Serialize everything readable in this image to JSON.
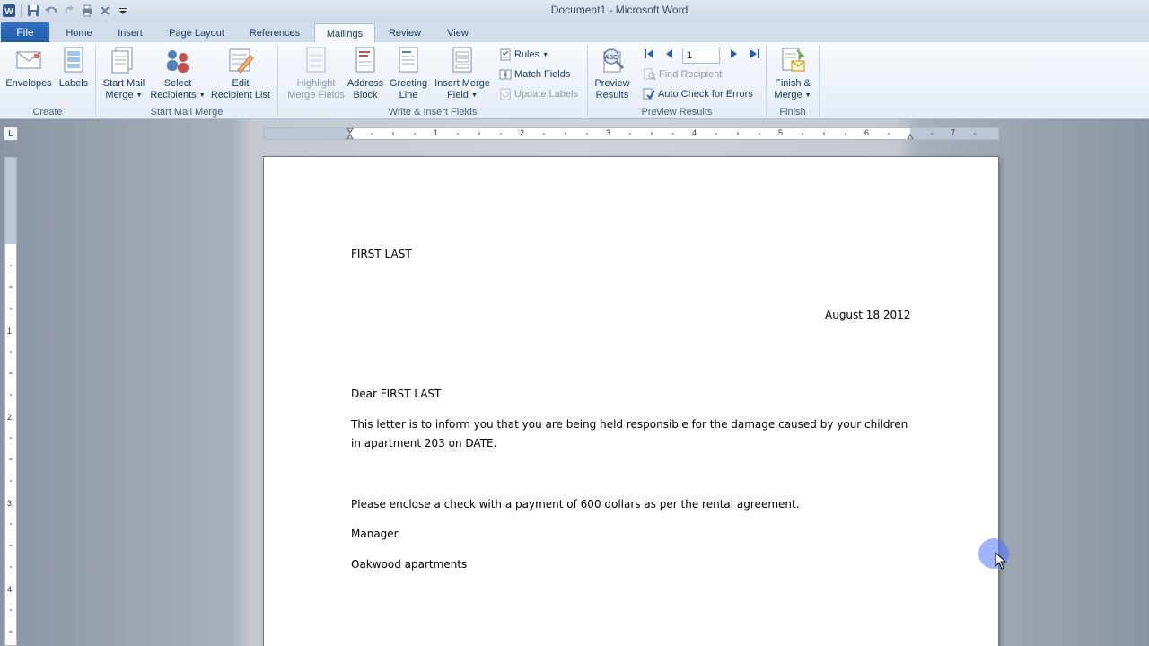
{
  "window": {
    "title": "Document1  -  Microsoft Word"
  },
  "tabs": {
    "file": "File",
    "items": [
      "Home",
      "Insert",
      "Page Layout",
      "References",
      "Mailings",
      "Review",
      "View"
    ],
    "active": "Mailings"
  },
  "ribbon": {
    "create": {
      "label": "Create",
      "envelopes": "Envelopes",
      "labels": "Labels"
    },
    "start_mail_merge": {
      "label": "Start Mail Merge",
      "start_l1": "Start Mail",
      "start_l2": "Merge",
      "select_l1": "Select",
      "select_l2": "Recipients",
      "edit_l1": "Edit",
      "edit_l2": "Recipient List"
    },
    "write_insert": {
      "label": "Write & Insert Fields",
      "highlight_l1": "Highlight",
      "highlight_l2": "Merge Fields",
      "address_l1": "Address",
      "address_l2": "Block",
      "greeting_l1": "Greeting",
      "greeting_l2": "Line",
      "insert_l1": "Insert Merge",
      "insert_l2": "Field",
      "rules": "Rules",
      "match_fields": "Match Fields",
      "update_labels": "Update Labels"
    },
    "preview_results": {
      "label": "Preview Results",
      "preview_l1": "Preview",
      "preview_l2": "Results",
      "record_value": "1",
      "find_recipient": "Find Recipient",
      "auto_check": "Auto Check for Errors"
    },
    "finish": {
      "label": "Finish",
      "finish_l1": "Finish &",
      "finish_l2": "Merge"
    }
  },
  "ruler": {
    "h_numbers": [
      "1",
      "2",
      "3",
      "4",
      "5",
      "6",
      "7"
    ],
    "v_numbers": [
      "1",
      "2",
      "3",
      "4"
    ]
  },
  "document": {
    "name_line": "FIRST LAST",
    "date": "August 18 2012",
    "salutation": "Dear FIRST LAST",
    "body1_l1": "This letter is to inform you that you are being held responsible for the damage caused by your children",
    "body1_l2": "in apartment 203  on DATE.",
    "body2": "Please enclose a check with a payment of 600  dollars as per the rental agreement.",
    "signoff1": "Manager",
    "signoff2": "Oakwood apartments"
  }
}
